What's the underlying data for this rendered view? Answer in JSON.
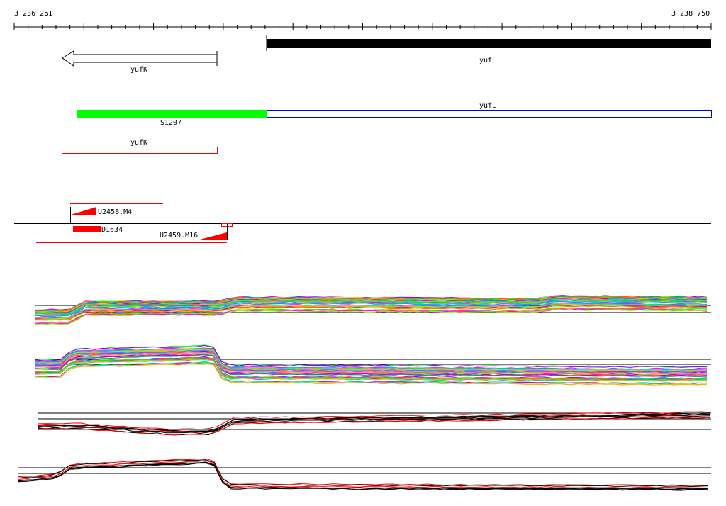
{
  "ruler": {
    "start_label": "3 236 251",
    "end_label": "3 238 750"
  },
  "genes": {
    "yufK_arrow_label": "yufK",
    "yufL_black_label": "yufL",
    "yufL_blue_label": "yufL",
    "S1207_label": "S1207",
    "yufK_red_label": "yufK"
  },
  "features": {
    "U2458_label": "U2458.M4",
    "D1634_label": "D1634",
    "U2459_label": "U2459.M16"
  },
  "colors": {
    "black": "#000000",
    "green": "#00ff00",
    "blue": "#0000ff",
    "red": "#ff0000",
    "track_palette": [
      "#ff00ff",
      "#00c0ff",
      "#00ff66",
      "#ffaa00",
      "#8000ff",
      "#ff4040",
      "#00aaaa",
      "#cccc00",
      "#4080ff",
      "#ff80c0",
      "#80ff00",
      "#c000c0",
      "#ffcc66",
      "#00ff00",
      "#ff6600"
    ]
  }
}
